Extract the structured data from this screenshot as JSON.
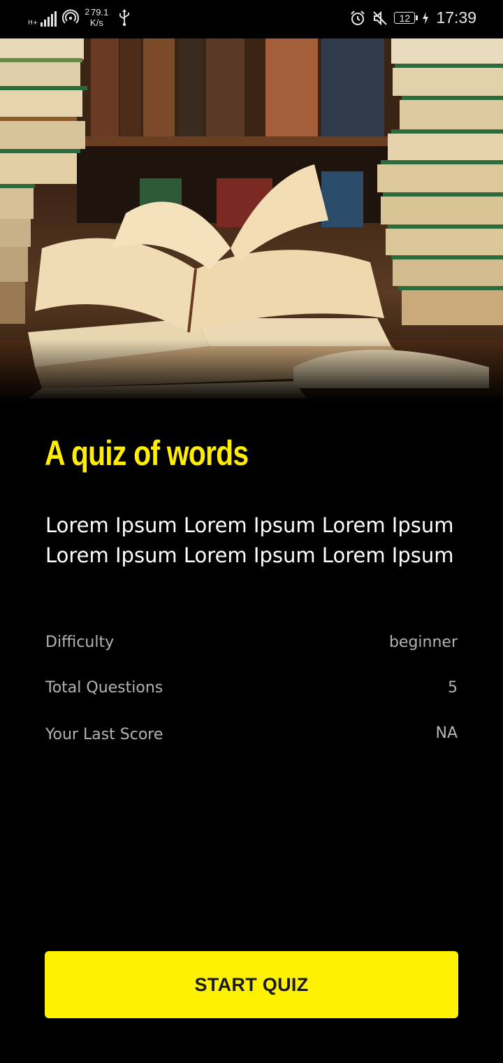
{
  "status_bar": {
    "network_type": "H+",
    "network_sup": "2",
    "network_speed_value": "79.1",
    "network_speed_unit": "K/s",
    "battery_level": "12",
    "time": "17:39"
  },
  "quiz": {
    "title": "A quiz of words",
    "description": "Lorem Ipsum Lorem Ipsum Lorem Ipsum Lorem Ipsum Lorem Ipsum Lorem Ipsum",
    "details": [
      {
        "label": "Difficulty",
        "value": "beginner"
      },
      {
        "label": "Total Questions",
        "value": "5"
      },
      {
        "label": "Your Last Score",
        "value": "NA"
      }
    ],
    "start_label": "START QUIZ"
  },
  "colors": {
    "accent": "#ffee00",
    "background": "#000000",
    "button": "#fff200",
    "muted_text": "#b3b3b3"
  },
  "icons": [
    "signal-icon",
    "hotspot-icon",
    "usb-icon",
    "alarm-icon",
    "mute-icon",
    "battery-icon",
    "charging-icon"
  ]
}
